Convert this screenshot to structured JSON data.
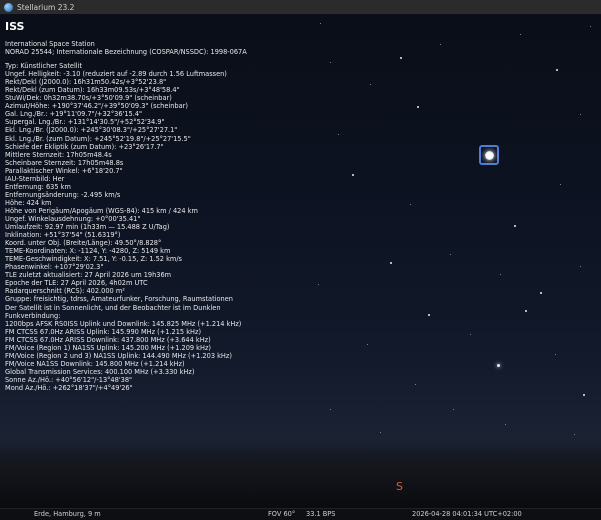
{
  "window": {
    "title": "Stellarium 23.2"
  },
  "info": {
    "object_title": "ISS",
    "lines_a": [
      "International Space Station",
      "NORAD 25544; Internationale Bezeichnung (COSPAR/NSSDC): 1998-067A"
    ],
    "lines_b": [
      "Typ: Künstlicher Satellit",
      "Ungef. Helligkeit: -3.10 (reduziert auf -2.89 durch 1.56 Luftmassen)",
      "Rekt/Dekl (J2000.0): 16h31m50.42s/+3°52'23.8\"",
      "Rekt/Dekl (zum Datum): 16h33m09.53s/+3°48'58.4\"",
      "StuWi/Dek: 0h32m38.70s/+3°50'09.9\" (scheinbar)",
      "Azimut/Höhe: +190°37'46.2\"/+39°50'09.3\" (scheinbar)",
      "Gal. Lng./Br.: +19°11'09.7\"/+32°36'15.4\"",
      "Supergal. Lng./Br.: +131°14'30.5\"/+52°52'34.9\"",
      "Ekl. Lng./Br. (J2000.0): +245°30'08.3\"/+25°27'27.1\"",
      "Ekl. Lng./Br. (zum Datum): +245°52'19.8\"/+25°27'15.5\"",
      "Schiefe der Ekliptik (zum Datum): +23°26'17.7\"",
      "Mittlere Sternzeit: 17h05m48.4s",
      "Scheinbare Sternzeit: 17h05m48.8s",
      "Parallaktischer Winkel: +6°18'20.7\"",
      "IAU-Sternbild: Her",
      "Entfernung: 635 km",
      "Entfernungsänderung: -2.495 km/s",
      "Höhe: 424 km",
      "Höhe von Perigäum/Apogäum (WGS-84): 415 km / 424 km",
      "Ungef. Winkelausdehnung: +0°00'35.41\"",
      "Umlaufzeit: 92.97 min (1h33m — 15.488 Z U/Tag)",
      "Inklination: +51°37'54\" (51.6319°)",
      "Koord. unter Obj. (Breite/Länge): 49.50°/8.828°",
      "TEME-Koordinaten: X: -1124, Y: -4280, Z: 5149 km",
      "TEME-Geschwindigkeit: X: 7.51, Y: -0.15, Z: 1.52 km/s",
      "Phasenwinkel: +107°29'02.3\"",
      "TLE zuletzt aktualisiert: 27 April 2026 um 19h36m",
      "Epoche der TLE: 27 April 2026, 4h02m UTC",
      "Radarquerschnitt (RCS): 402.000 m²",
      "Gruppe: freisichtig, tdrss, Amateurfunker, Forschung, Raumstationen",
      "Der Satellit ist in Sonnenlicht, und der Beobachter ist im Dunklen",
      "Funkverbindung:",
      "1200bps AFSK RS0ISS Uplink und Downlink: 145.825 MHz (+1.214 kHz)",
      "FM CTCSS 67.0Hz ARISS Uplink: 145.990 MHz (+1.215 kHz)",
      "FM CTCSS 67.0Hz ARISS Downlink: 437.800 MHz (+3.644 kHz)",
      "FM/Voice (Region 1) NA1SS Uplink: 145.200 MHz (+1.209 kHz)",
      "FM/Voice (Region 2 und 3) NA1SS Uplink: 144.490 MHz (+1.203 kHz)",
      "FM/Voice NA1SS Downlink: 145.800 MHz (+1.214 kHz)",
      "Global Transmission Services: 400.100 MHz (+3.330 kHz)",
      "Sonne Az./Hö.: +40°56'12\"/-13°48'38\"",
      "Mond Az./Hö.: +262°18'37\"/+4°49'26\""
    ]
  },
  "sky": {
    "compass_label": "S",
    "compass_color": "#e05a3a",
    "marker_color": "#4d7bd8"
  },
  "status": {
    "location": "Erde, Hamburg, 9 m",
    "fov": "FOV 60°",
    "fps": "33.1 BPS",
    "datetime": "2026-04-28 04:01:34 UTC+02:00"
  }
}
